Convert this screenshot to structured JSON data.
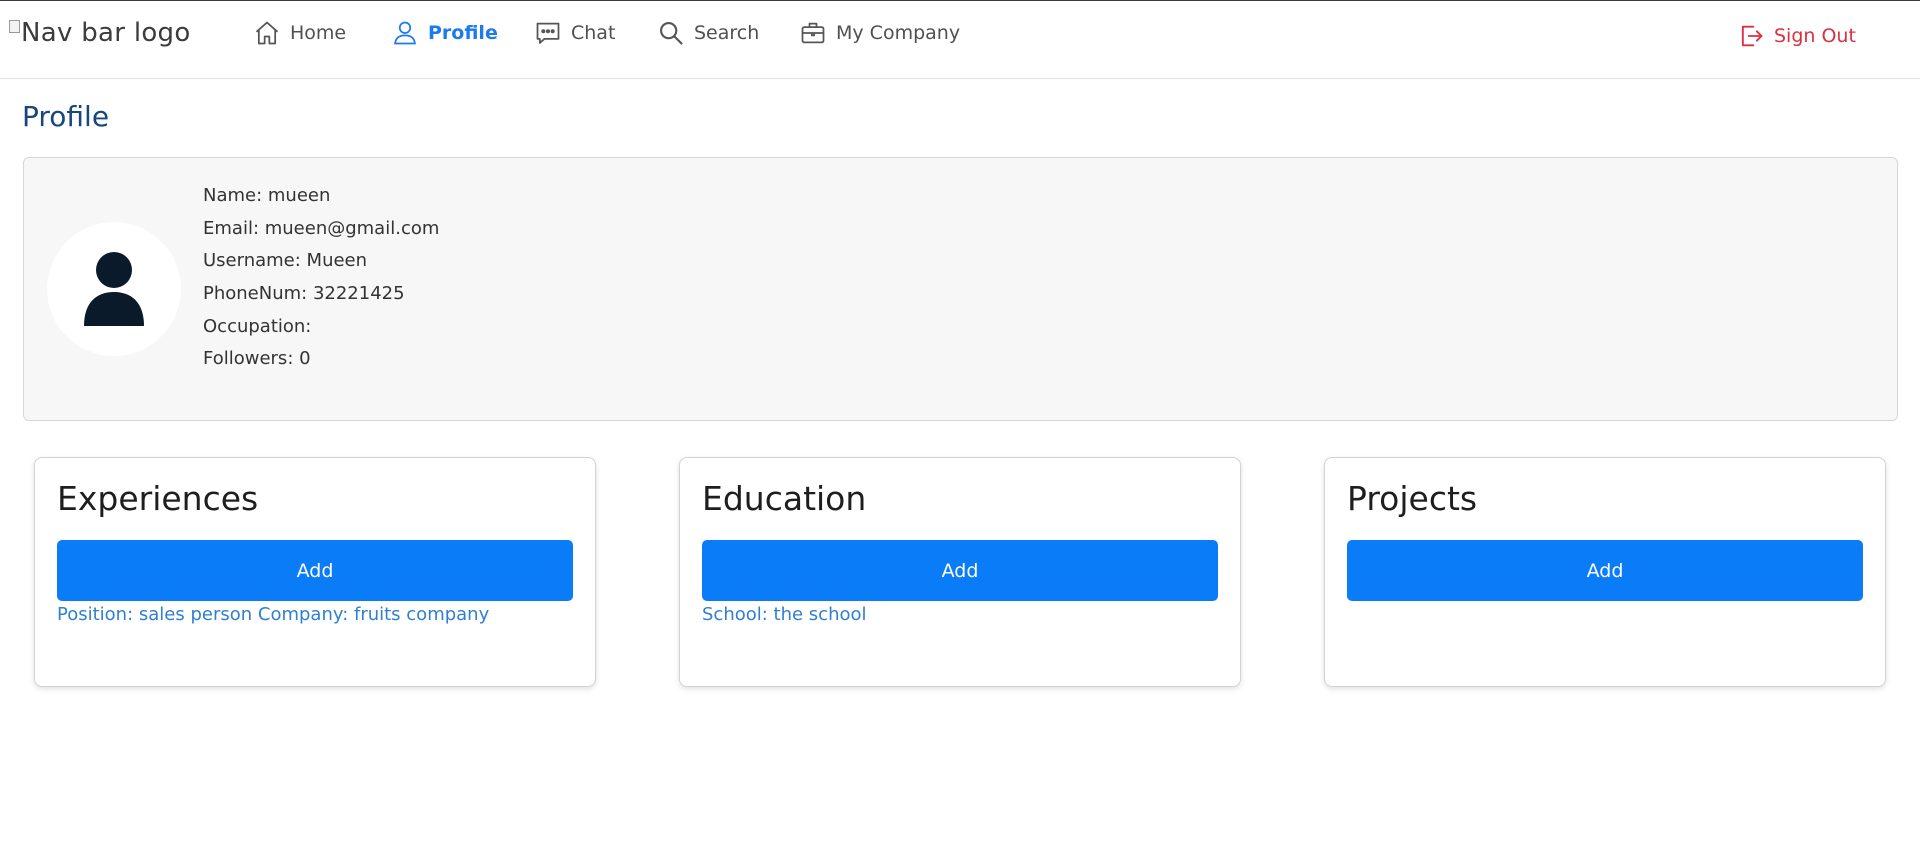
{
  "nav": {
    "brand_alt": "Nav bar logo",
    "items": [
      {
        "label": "Home",
        "icon": "home-icon",
        "active": false
      },
      {
        "label": "Profile",
        "icon": "user-icon",
        "active": true
      },
      {
        "label": "Chat",
        "icon": "chat-icon",
        "active": false
      },
      {
        "label": "Search",
        "icon": "search-icon",
        "active": false
      },
      {
        "label": "My Company",
        "icon": "briefcase-icon",
        "active": false
      }
    ],
    "signout_label": "Sign Out"
  },
  "page": {
    "title": "Profile"
  },
  "profile": {
    "avatar_icon": "person-icon",
    "fields": [
      "Name: mueen",
      "Email: mueen@gmail.com",
      "Username: Mueen",
      "PhoneNum: 32221425",
      "Occupation:",
      "Followers: 0"
    ]
  },
  "sections": {
    "experiences": {
      "title": "Experiences",
      "add_label": "Add",
      "entries": [
        "Position: sales person Company: fruits company"
      ]
    },
    "education": {
      "title": "Education",
      "add_label": "Add",
      "entries": [
        "School: the school"
      ]
    },
    "projects": {
      "title": "Projects",
      "add_label": "Add",
      "entries": []
    }
  },
  "colors": {
    "accent": "#0a7cf8",
    "active_nav": "#1b7bee",
    "signout": "#d8313f",
    "title": "#18477a",
    "link": "#2f7fd2"
  }
}
